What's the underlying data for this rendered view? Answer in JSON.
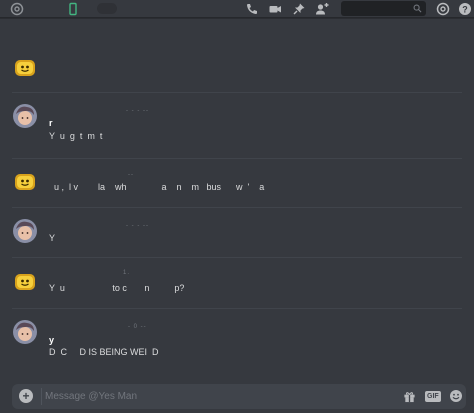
{
  "topbar": {
    "search_placeholder": "",
    "icons": [
      "at-icon",
      "mobile-icon",
      "call-icon",
      "video-icon",
      "pin-icon",
      "add-member-icon",
      "search-icon",
      "mention-icon",
      "help-icon"
    ]
  },
  "messages": [
    {
      "author": "",
      "timestamp": "",
      "lines": []
    },
    {
      "author": "r",
      "timestamp": "- - - --",
      "lines": [
        "Y  u  g  t  m  t"
      ]
    },
    {
      "author": "",
      "timestamp": "--",
      "lines": [
        "  u ,  l v        la    wh              a    n    m   bus      w  '    a"
      ]
    },
    {
      "author": "",
      "timestamp": "- - - --",
      "lines": [
        "Y"
      ]
    },
    {
      "author": "",
      "timestamp": "1.",
      "lines": [
        "Y  u                   to c       n          p?"
      ]
    },
    {
      "author": "y",
      "timestamp": "- 0 --",
      "lines": [
        "D  C     D IS BEING WEI  D"
      ]
    }
  ],
  "composer": {
    "placeholder": "Message @Yes Man",
    "value": "",
    "gif_label": "GIF"
  },
  "colors": {
    "background": "#36393f",
    "composer": "#40444b",
    "online": "#43b581"
  }
}
